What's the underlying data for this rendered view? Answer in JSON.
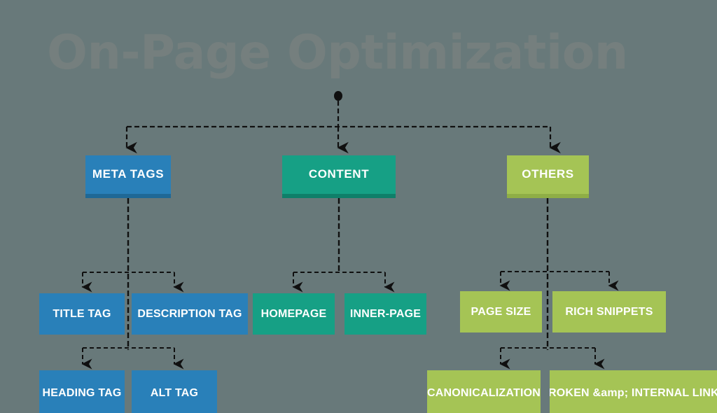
{
  "diagram": {
    "title": "On-Page Optimization",
    "root": {
      "label": "",
      "icon": "root-dot"
    },
    "colors": {
      "background": "#68797a",
      "title_text": "#757f7e",
      "blue": "#2980b9",
      "blue_shadow": "#1f6896",
      "teal": "#16a085",
      "teal_shadow": "#0f7f69",
      "olive": "#a5c455",
      "olive_shadow": "#8fae46",
      "connector": "#101010",
      "node_text": "#ffffff"
    },
    "branches": [
      {
        "id": "meta-tags",
        "label": "META TAGS",
        "color": "blue",
        "children": [
          {
            "id": "title-tag",
            "label": "TITLE TAG",
            "color": "blue"
          },
          {
            "id": "description-tag",
            "label": "DESCRIPTION TAG",
            "color": "blue"
          }
        ],
        "grandchildren": [
          {
            "id": "heading-tag",
            "label": "HEADING TAG",
            "color": "blue"
          },
          {
            "id": "alt-tag",
            "label": "ALT TAG",
            "color": "blue"
          }
        ]
      },
      {
        "id": "content",
        "label": "CONTENT",
        "color": "teal",
        "children": [
          {
            "id": "homepage",
            "label": "HOMEPAGE",
            "color": "teal"
          },
          {
            "id": "inner-page",
            "label": "INNER-PAGE",
            "color": "teal"
          }
        ],
        "grandchildren": []
      },
      {
        "id": "others",
        "label": "OTHERS",
        "color": "olive",
        "children": [
          {
            "id": "page-size",
            "label": "PAGE SIZE",
            "color": "olive"
          },
          {
            "id": "rich-snippets",
            "label": "RICH SNIPPETS",
            "color": "olive"
          }
        ],
        "grandchildren": [
          {
            "id": "canonicalization",
            "label": "CANONICALIZATION",
            "color": "olive"
          },
          {
            "id": "broken-internal-links",
            "label": "BROKEN &amp; INTERNAL LINKS",
            "color": "olive"
          }
        ]
      }
    ]
  }
}
